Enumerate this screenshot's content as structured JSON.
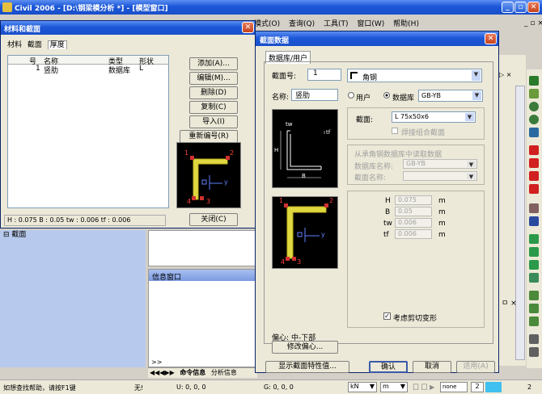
{
  "app": {
    "title": "Civil 2006 - [D:\\钢梁模分析 *] - [模型窗口]",
    "menu": [
      "模式(O)",
      "查询(Q)",
      "工具(T)",
      "窗口(W)",
      "帮助(H)"
    ],
    "status_left": "如想查找帮助，请按F1键",
    "status_items": [
      "无!",
      "U: 0, 0, 0",
      "G: 0, 0, 0"
    ],
    "status_units": [
      "kN",
      "m"
    ],
    "status_small": [
      "none",
      "2"
    ],
    "status_right": "2",
    "info_window_title": "信息窗口",
    "info_tabs": [
      "命令信息",
      "分析信息"
    ],
    "info_prompt": ">>",
    "tree_node": "截面"
  },
  "material_dialog": {
    "title": "材料和截面",
    "tabs": [
      "材料",
      "截面",
      "厚度"
    ],
    "columns": [
      "号",
      "名称",
      "类型",
      "形状"
    ],
    "rows": [
      {
        "no": "1",
        "name": "竖肋",
        "type": "数据库",
        "shape": "L"
      }
    ],
    "buttons": [
      "添加(A)...",
      "编辑(M)...",
      "删除(D)",
      "复制(C)",
      "导入(I)",
      "重新编号(R)"
    ],
    "summary": "H : 0.075  B : 0.05  tw : 0.006  tf : 0.006",
    "close_button": "关闭(C)",
    "preview_labels": {
      "top_left": "1",
      "top_right": "2",
      "bottom_left": "4",
      "bottom_right": "3",
      "axis": "y"
    }
  },
  "section_dialog": {
    "title": "截面数据",
    "tab": "数据库/用户",
    "section_no_label": "截面号:",
    "section_no_value": "1",
    "shape_value": "角钢",
    "name_label": "名称:",
    "name_value": "竖肋",
    "radio_user": "用户",
    "radio_db": "数据库",
    "db_value": "GB-YB",
    "section_label": "截面:",
    "section_value": "L 75x50x6",
    "weld_check": "焊接组合截面",
    "from_db": "从承角钢数据库中读取数据",
    "db_name_label": "数据库名称:",
    "db_name_value": "GB-YB",
    "section_name_label": "截面名称:",
    "params": [
      {
        "name": "H",
        "value": "0.075",
        "unit": "m"
      },
      {
        "name": "B",
        "value": "0.05",
        "unit": "m"
      },
      {
        "name": "tw",
        "value": "0.006",
        "unit": "m"
      },
      {
        "name": "tf",
        "value": "0.006",
        "unit": "m"
      }
    ],
    "shear_check": "考虑剪切变形",
    "offset_label": "偏心:",
    "offset_value": "中-下部",
    "modify_offset": "修改偏心...",
    "show_props": "显示截面特性值...",
    "ok": "确认",
    "cancel": "取消",
    "apply": "适用(A)",
    "diagram_labels": {
      "tw": "tw",
      "tf": "tf",
      "h": "H",
      "b": "B"
    },
    "preview_labels": {
      "top_left": "1",
      "top_right": "2",
      "bottom_left": "4",
      "bottom_right": "3",
      "axis": "y"
    }
  }
}
